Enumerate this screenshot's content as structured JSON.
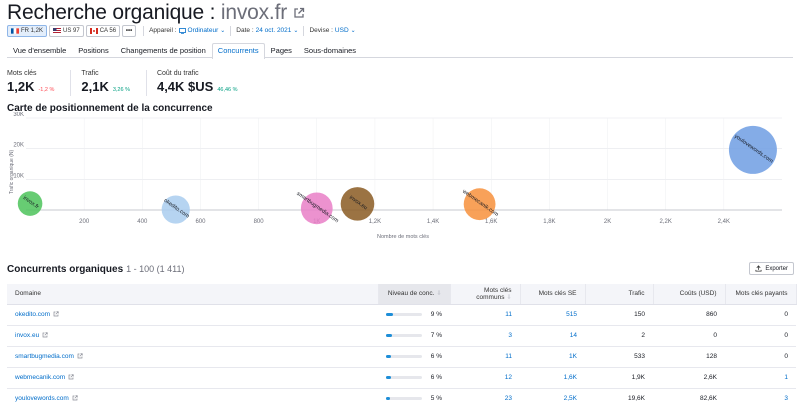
{
  "header": {
    "title_prefix": "Recherche organique : ",
    "domain": "invox.fr"
  },
  "filters": {
    "databases": [
      {
        "label": "FR 1,2K",
        "flag": "fr",
        "active": true
      },
      {
        "label": "US 97",
        "flag": "us",
        "active": false
      },
      {
        "label": "CA 56",
        "flag": "ca",
        "active": false
      }
    ],
    "more_label": "•••",
    "device_label": "Appareil :",
    "device_value": "Ordinateur",
    "date_label": "Date :",
    "date_value": "24 oct. 2021",
    "currency_label": "Devise :",
    "currency_value": "USD"
  },
  "tabs": [
    {
      "label": "Vue d'ensemble",
      "active": false
    },
    {
      "label": "Positions",
      "active": false
    },
    {
      "label": "Changements de position",
      "active": false
    },
    {
      "label": "Concurrents",
      "active": true
    },
    {
      "label": "Pages",
      "active": false
    },
    {
      "label": "Sous-domaines",
      "active": false
    }
  ],
  "metrics": [
    {
      "label": "Mots clés",
      "value": "1,2K",
      "change": "-1,2 %",
      "trend": "neg"
    },
    {
      "label": "Trafic",
      "value": "2,1K",
      "change": "3,26 %",
      "trend": "pos"
    },
    {
      "label": "Coût du trafic",
      "value": "4,4K $US",
      "change": "46,46 %",
      "trend": "pos"
    }
  ],
  "chart_title": "Carte de positionnement de la concurrence",
  "chart_data": {
    "type": "scatter",
    "title": "Carte de positionnement de la concurrence",
    "xlabel": "Nombre de mots clés",
    "ylabel": "Trafic organique (N)",
    "xlim": [
      0,
      2600
    ],
    "ylim": [
      0,
      30000
    ],
    "x_ticks": [
      200,
      400,
      600,
      800,
      1000,
      1200,
      1400,
      1600,
      1800,
      2000,
      2200,
      2400
    ],
    "x_tick_labels": [
      "200",
      "400",
      "600",
      "800",
      "1K",
      "1,2K",
      "1,4K",
      "1,6K",
      "1,8K",
      "2K",
      "2,2K",
      "2,4K"
    ],
    "y_ticks": [
      10000,
      20000,
      30000
    ],
    "y_tick_labels": [
      "10K",
      "20K",
      "30K"
    ],
    "grid": true,
    "points": [
      {
        "label": "invox.fr",
        "x": 14,
        "y": 2100,
        "color": "#4cc35a",
        "size": 0.35
      },
      {
        "label": "okedito.com",
        "x": 515,
        "y": 150,
        "color": "#a9cdef",
        "size": 0.45
      },
      {
        "label": "smartbugmedia.com",
        "x": 1000,
        "y": 533,
        "color": "#e97fc7",
        "size": 0.55
      },
      {
        "label": "invox.eu",
        "x": 1140,
        "y": 2000,
        "color": "#8a5a22",
        "size": 0.6
      },
      {
        "label": "webmecanik.com",
        "x": 1560,
        "y": 1900,
        "color": "#f7903c",
        "size": 0.55
      },
      {
        "label": "youlovewords.com",
        "x": 2500,
        "y": 19600,
        "color": "#6f9de3",
        "size": 1.0
      }
    ]
  },
  "section": {
    "title": "Concurrents organiques",
    "range": "1 - 100 (1 411)",
    "export_label": "Exporter"
  },
  "table": {
    "columns": [
      "Domaine",
      "Niveau de conc.",
      "Mots clés communs",
      "Mots clés SE",
      "Trafic",
      "Coûts (USD)",
      "Mots clés payants"
    ],
    "rows": [
      {
        "domain": "okedito.com",
        "level": "9 %",
        "level_pct": 9,
        "common": "11",
        "se": "515",
        "traffic": "150",
        "cost": "860",
        "paid": "0"
      },
      {
        "domain": "invox.eu",
        "level": "7 %",
        "level_pct": 7,
        "common": "3",
        "se": "14",
        "traffic": "2",
        "cost": "0",
        "paid": "0"
      },
      {
        "domain": "smartbugmedia.com",
        "level": "6 %",
        "level_pct": 6,
        "common": "11",
        "se": "1K",
        "traffic": "533",
        "cost": "128",
        "paid": "0"
      },
      {
        "domain": "webmecanik.com",
        "level": "6 %",
        "level_pct": 6,
        "common": "12",
        "se": "1,6K",
        "traffic": "1,9K",
        "cost": "2,6K",
        "paid": "1"
      },
      {
        "domain": "youlovewords.com",
        "level": "5 %",
        "level_pct": 5,
        "common": "23",
        "se": "2,5K",
        "traffic": "19,6K",
        "cost": "82,6K",
        "paid": "3"
      }
    ]
  }
}
